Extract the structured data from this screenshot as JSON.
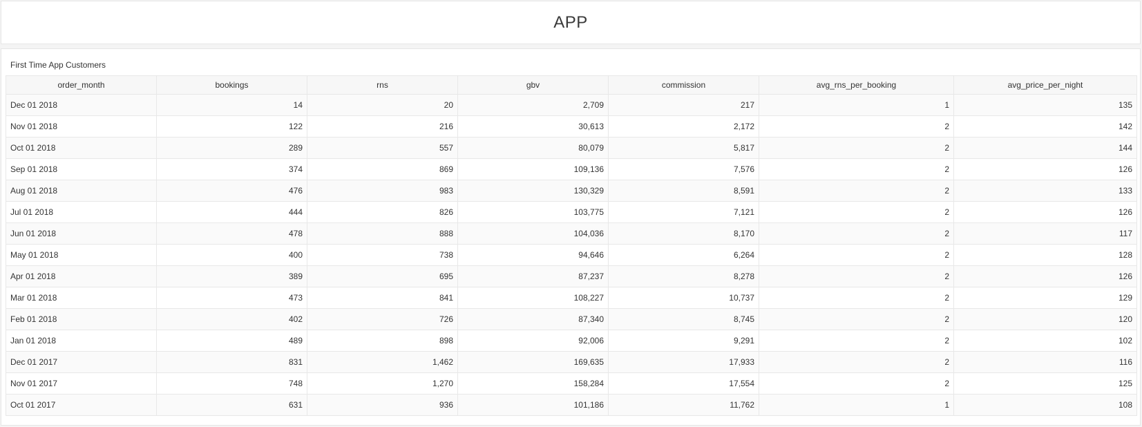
{
  "header": {
    "title": "APP"
  },
  "panel": {
    "title": "First Time App Customers"
  },
  "table": {
    "columns": [
      "order_month",
      "bookings",
      "rns",
      "gbv",
      "commission",
      "avg_rns_per_booking",
      "avg_price_per_night"
    ],
    "rows": [
      [
        "Dec 01 2018",
        "14",
        "20",
        "2,709",
        "217",
        "1",
        "135"
      ],
      [
        "Nov 01 2018",
        "122",
        "216",
        "30,613",
        "2,172",
        "2",
        "142"
      ],
      [
        "Oct 01 2018",
        "289",
        "557",
        "80,079",
        "5,817",
        "2",
        "144"
      ],
      [
        "Sep 01 2018",
        "374",
        "869",
        "109,136",
        "7,576",
        "2",
        "126"
      ],
      [
        "Aug 01 2018",
        "476",
        "983",
        "130,329",
        "8,591",
        "2",
        "133"
      ],
      [
        "Jul 01 2018",
        "444",
        "826",
        "103,775",
        "7,121",
        "2",
        "126"
      ],
      [
        "Jun 01 2018",
        "478",
        "888",
        "104,036",
        "8,170",
        "2",
        "117"
      ],
      [
        "May 01 2018",
        "400",
        "738",
        "94,646",
        "6,264",
        "2",
        "128"
      ],
      [
        "Apr 01 2018",
        "389",
        "695",
        "87,237",
        "8,278",
        "2",
        "126"
      ],
      [
        "Mar 01 2018",
        "473",
        "841",
        "108,227",
        "10,737",
        "2",
        "129"
      ],
      [
        "Feb 01 2018",
        "402",
        "726",
        "87,340",
        "8,745",
        "2",
        "120"
      ],
      [
        "Jan 01 2018",
        "489",
        "898",
        "92,006",
        "9,291",
        "2",
        "102"
      ],
      [
        "Dec 01 2017",
        "831",
        "1,462",
        "169,635",
        "17,933",
        "2",
        "116"
      ],
      [
        "Nov 01 2017",
        "748",
        "1,270",
        "158,284",
        "17,554",
        "2",
        "125"
      ],
      [
        "Oct 01 2017",
        "631",
        "936",
        "101,186",
        "11,762",
        "1",
        "108"
      ]
    ]
  }
}
